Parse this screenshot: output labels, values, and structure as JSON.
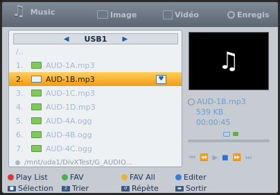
{
  "tabs": {
    "music": "Music",
    "image": "Image",
    "video": "Vidéo",
    "record": "Enregis"
  },
  "list": {
    "directory": "USB1",
    "parent": "/..",
    "items": [
      {
        "num": "1.",
        "name": "AUD-1A.mp3",
        "selected": false
      },
      {
        "num": "2.",
        "name": "AUD-1B.mp3",
        "selected": true
      },
      {
        "num": "3.",
        "name": "AUD-1C.mp3",
        "selected": false
      },
      {
        "num": "4.",
        "name": "AUD-1D.mp3",
        "selected": false
      },
      {
        "num": "5.",
        "name": "AUD-4A.ogg",
        "selected": false
      },
      {
        "num": "6.",
        "name": "AUD-4B.ogg",
        "selected": false
      },
      {
        "num": "7.",
        "name": "AUD-4C.ogg",
        "selected": false
      }
    ],
    "path": "/mnt/uda1/DivXTest/G_AUDIO..."
  },
  "info": {
    "filename": "AUD-1B.mp3",
    "size": "539 KB",
    "duration": "00:00:45"
  },
  "legend": {
    "playlist": "Play List",
    "fav": "FAV",
    "fav_all": "FAV All",
    "edit": "Editer",
    "select": "Sélection",
    "sort": "Trier",
    "repeat": "Répète",
    "exit": "Sortir"
  },
  "colors": {
    "selected_row": "#f7a623",
    "panel_bg": "#eef1f4",
    "accent": "#2a6fd0"
  }
}
